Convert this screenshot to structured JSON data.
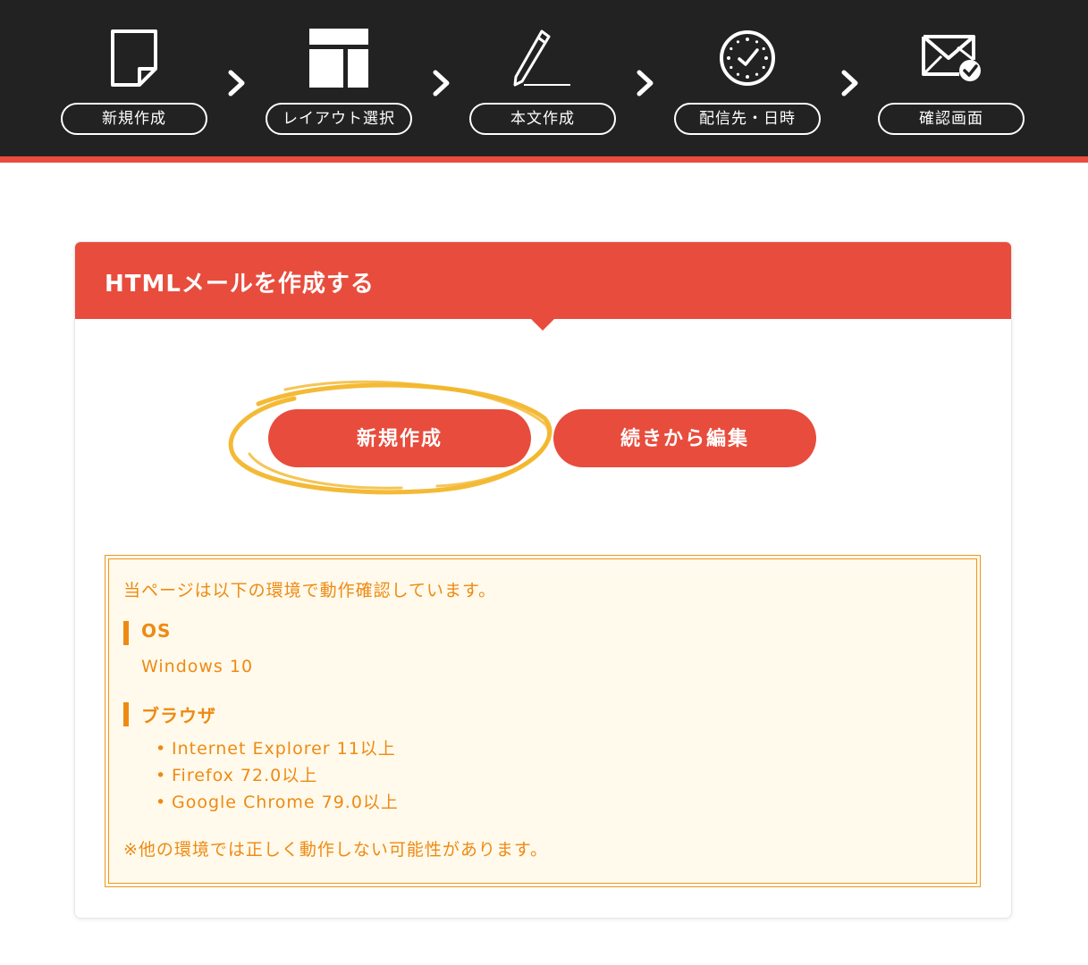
{
  "steps": [
    {
      "label": "新規作成",
      "icon": "document-icon"
    },
    {
      "label": "レイアウト選択",
      "icon": "layout-icon"
    },
    {
      "label": "本文作成",
      "icon": "pencil-icon"
    },
    {
      "label": "配信先・日時",
      "icon": "clock-icon"
    },
    {
      "label": "確認画面",
      "icon": "mail-check-icon"
    }
  ],
  "colors": {
    "header_bg": "#222222",
    "accent": "#e84c3d",
    "notice_text": "#ee8a14",
    "notice_bg": "#fffaeb",
    "highlight": "#f3b62b"
  },
  "card": {
    "title": "HTMLメールを作成する",
    "new_button": "新規作成",
    "continue_button": "続きから編集"
  },
  "notice": {
    "lead": "当ページは以下の環境で動作確認しています。",
    "os_heading": "OS",
    "os_value": "Windows 10",
    "browser_heading": "ブラウザ",
    "browsers": [
      "Internet Explorer 11以上",
      "Firefox 72.0以上",
      "Google Chrome 79.0以上"
    ],
    "footnote": "※他の環境では正しく動作しない可能性があります。"
  }
}
